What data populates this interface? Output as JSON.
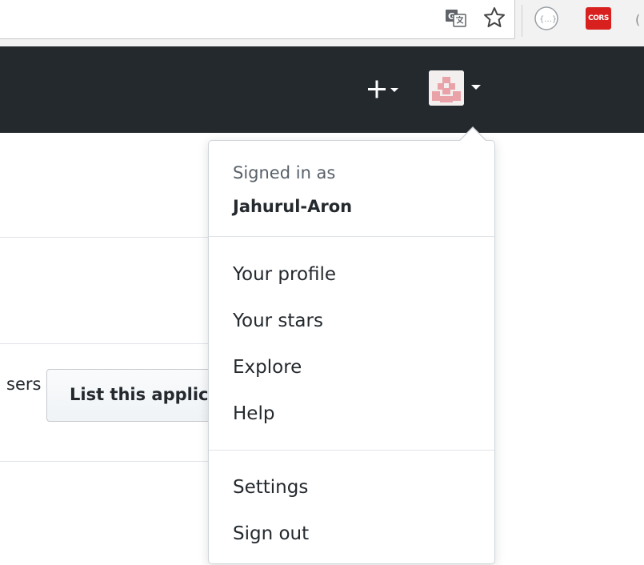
{
  "browser": {
    "icons": {
      "translate": "google-translate-icon",
      "bookmark": "star-icon",
      "extension_1": "json-viewer-extension-icon",
      "cors": "cors-extension-icon",
      "extension_2": "extension-icon"
    },
    "cors_label": "CORS"
  },
  "header": {
    "new_menu_icon": "plus-icon",
    "caret_icon": "caret-down-icon",
    "avatar_icon": "identicon-avatar",
    "background": "#24292e"
  },
  "page": {
    "partial_text": "sers",
    "list_button_label": "List this applic"
  },
  "user_menu": {
    "signed_in_label": "Signed in as",
    "username": "Jahurul-Aron",
    "items": [
      {
        "label": "Your profile"
      },
      {
        "label": "Your stars"
      },
      {
        "label": "Explore"
      },
      {
        "label": "Help"
      }
    ],
    "footer_items": [
      {
        "label": "Settings"
      },
      {
        "label": "Sign out"
      }
    ]
  },
  "colors": {
    "header_bg": "#24292e",
    "cors_red": "#d8211f",
    "avatar_pink": "#e9a3a8",
    "text_primary": "#24292e",
    "text_muted": "#586069"
  }
}
